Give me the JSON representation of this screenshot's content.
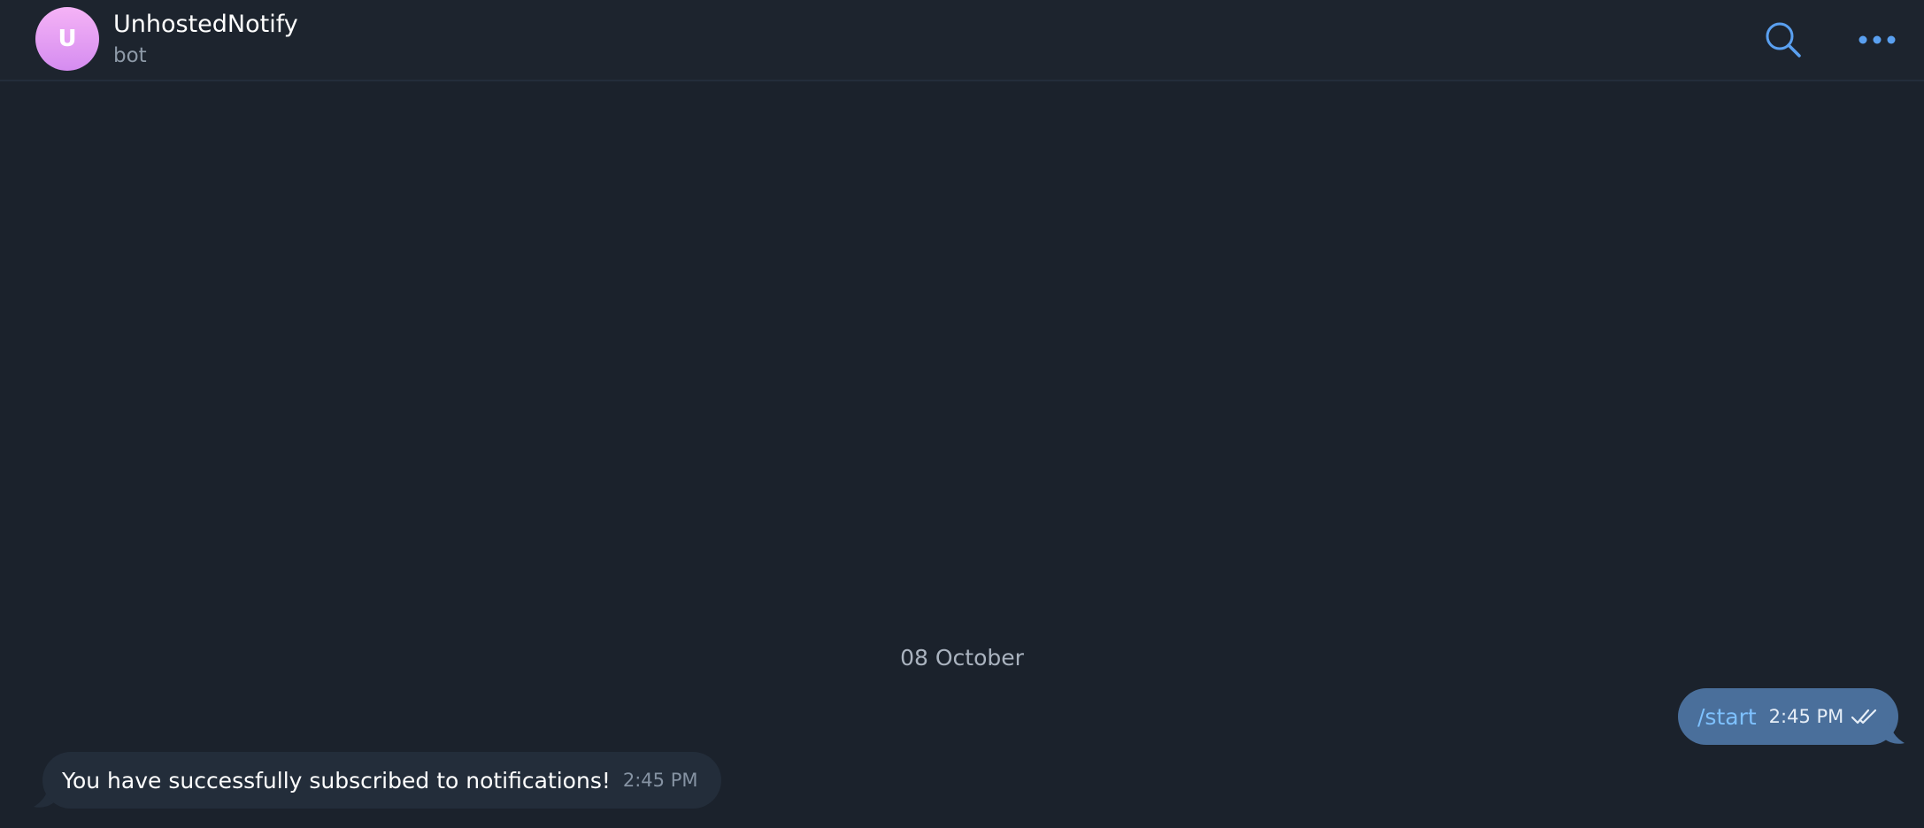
{
  "header": {
    "avatar_letter": "U",
    "title": "UnhostedNotify",
    "subtitle": "bot",
    "actions": [
      {
        "icon": "search-icon"
      },
      {
        "icon": "more-icon"
      }
    ]
  },
  "chat": {
    "date_separator": "08 October",
    "messages": [
      {
        "direction": "outgoing",
        "text": "/start",
        "time": "2:45 PM",
        "status_icon": "double-check-icon"
      },
      {
        "direction": "incoming",
        "text": "You have successfully subscribed to notifications!",
        "time": "2:45 PM"
      }
    ]
  },
  "colors": {
    "background": "#1b222c",
    "header_bg": "#1d242e",
    "accent": "#5aa0f0",
    "outgoing_bubble": "#4a6f9b",
    "incoming_bubble": "#232d3a",
    "command_link": "#7ec1ff"
  }
}
